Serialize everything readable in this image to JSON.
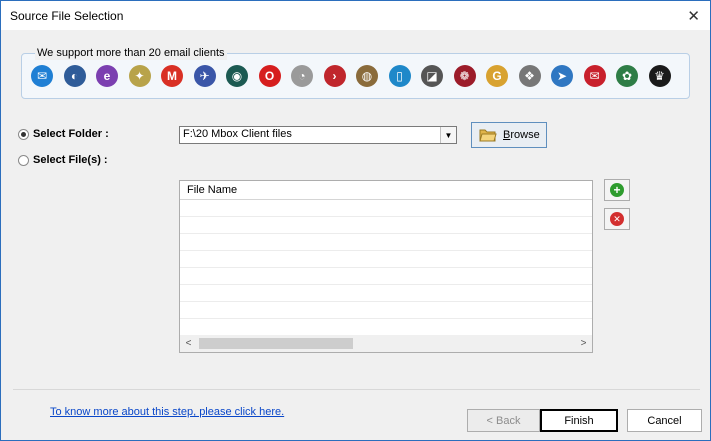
{
  "window": {
    "title": "Source File Selection",
    "close_glyph": "✕"
  },
  "clients": {
    "legend": "We support more than 20 email clients",
    "icons": [
      {
        "name": "mail-envelope-icon",
        "color": "#1f7fd4",
        "glyph": "✉"
      },
      {
        "name": "thunderbird-icon",
        "color": "#2f5c99",
        "glyph": "◐"
      },
      {
        "name": "eudora-icon",
        "color": "#7b3fb0",
        "glyph": "e"
      },
      {
        "name": "pocomail-icon",
        "color": "#b8a34a",
        "glyph": "✦"
      },
      {
        "name": "gmail-icon",
        "color": "#d93025",
        "glyph": "M"
      },
      {
        "name": "postbox-icon",
        "color": "#3a56a8",
        "glyph": "✈"
      },
      {
        "name": "seamonkey-icon",
        "color": "#1c5a52",
        "glyph": "◉"
      },
      {
        "name": "opera-mail-icon",
        "color": "#d61e1e",
        "glyph": "O"
      },
      {
        "name": "mail-clock-icon",
        "color": "#9a9a9a",
        "glyph": "◔"
      },
      {
        "name": "mulberry-icon",
        "color": "#c0262c",
        "glyph": "›"
      },
      {
        "name": "apple-mail-icon",
        "color": "#8a6b3b",
        "glyph": "◍"
      },
      {
        "name": "netscape-icon",
        "color": "#1e88c9",
        "glyph": "▯"
      },
      {
        "name": "entourage-icon",
        "color": "#555555",
        "glyph": "◪"
      },
      {
        "name": "claws-mail-icon",
        "color": "#9c1c2a",
        "glyph": "❁"
      },
      {
        "name": "gyazmail-icon",
        "color": "#d8a230",
        "glyph": "G"
      },
      {
        "name": "sylpheed-icon",
        "color": "#777777",
        "glyph": "❖"
      },
      {
        "name": "sparrow-icon",
        "color": "#2f77c2",
        "glyph": "➤"
      },
      {
        "name": "mail-red-icon",
        "color": "#c8202c",
        "glyph": "✉"
      },
      {
        "name": "mailcopa-icon",
        "color": "#2e7d46",
        "glyph": "✿"
      },
      {
        "name": "the-bat-icon",
        "color": "#1a1a1a",
        "glyph": "♛"
      }
    ]
  },
  "source": {
    "select_folder_label": "Select Folder :",
    "select_files_label": "Select File(s) :",
    "folder_path": "F:\\20 Mbox Client files",
    "browse_label": "Browse"
  },
  "file_list": {
    "column_header": "File Name",
    "rows": []
  },
  "side_buttons": {
    "add_glyph": "+",
    "remove_glyph": "✕",
    "add_color": "#2e9c2e",
    "remove_color": "#d32f2f"
  },
  "footer": {
    "help_link": "To know more about this step, please click here.",
    "back_label": "< Back",
    "finish_label": "Finish",
    "cancel_label": "Cancel"
  }
}
